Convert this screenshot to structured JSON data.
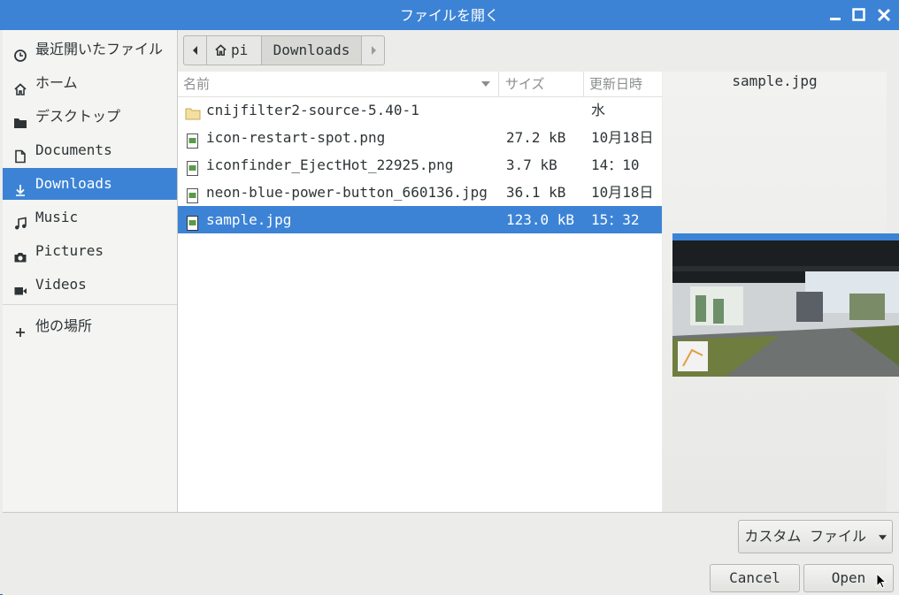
{
  "window": {
    "title": "ファイルを開く"
  },
  "sidebar": {
    "items": [
      {
        "label": "最近開いたファイル",
        "icon": "clock-icon"
      },
      {
        "label": "ホーム",
        "icon": "home-icon"
      },
      {
        "label": "デスクトップ",
        "icon": "folder-icon"
      },
      {
        "label": "Documents",
        "icon": "document-icon"
      },
      {
        "label": "Downloads",
        "icon": "download-icon",
        "active": true
      },
      {
        "label": "Music",
        "icon": "music-icon"
      },
      {
        "label": "Pictures",
        "icon": "camera-icon"
      },
      {
        "label": "Videos",
        "icon": "video-icon"
      }
    ],
    "other": {
      "label": "他の場所",
      "icon": "plus-icon"
    }
  },
  "pathbar": {
    "segments": [
      "pi",
      "Downloads"
    ]
  },
  "filelist": {
    "columns": {
      "name": "名前",
      "size": "サイズ",
      "modified": "更新日時"
    },
    "rows": [
      {
        "name": "cnijfilter2-source-5.40-1",
        "size": "",
        "modified": "水",
        "type": "folder"
      },
      {
        "name": "icon-restart-spot.png",
        "size": "27.2 kB",
        "modified": "10月18日",
        "type": "image"
      },
      {
        "name": "iconfinder_EjectHot_22925.png",
        "size": "3.7 kB",
        "modified": "14：10",
        "type": "image"
      },
      {
        "name": "neon-blue-power-button_660136.jpg",
        "size": "36.1 kB",
        "modified": "10月18日",
        "type": "image"
      },
      {
        "name": "sample.jpg",
        "size": "123.0 kB",
        "modified": "15：32",
        "type": "image",
        "selected": true
      }
    ]
  },
  "preview": {
    "filename": "sample.jpg"
  },
  "filter": {
    "label": "カスタム ファイル"
  },
  "buttons": {
    "cancel": "Cancel",
    "open": "Open"
  },
  "colors": {
    "accent": "#3c83d6",
    "titlebar": "#3c83d6"
  }
}
